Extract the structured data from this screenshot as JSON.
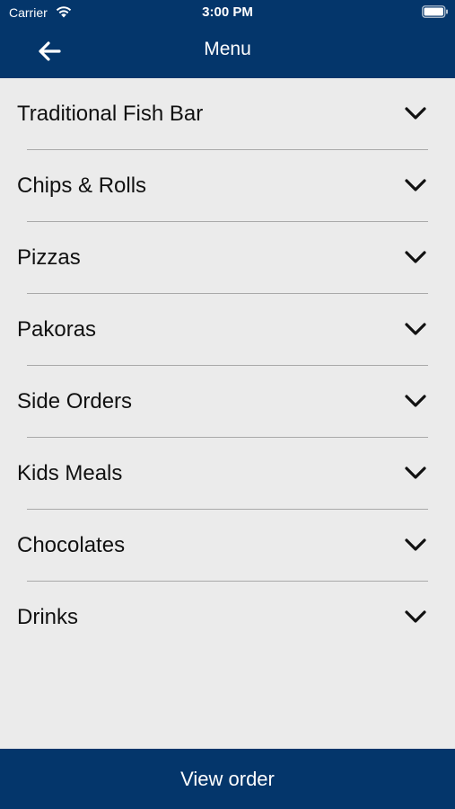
{
  "status_bar": {
    "carrier": "Carrier",
    "time": "3:00 PM",
    "icons": [
      "wifi-icon",
      "battery-icon"
    ]
  },
  "header": {
    "title": "Menu",
    "back_icon": "arrow-left-icon"
  },
  "menu": {
    "items": [
      {
        "label": "Traditional Fish Bar"
      },
      {
        "label": "Chips & Rolls"
      },
      {
        "label": "Pizzas"
      },
      {
        "label": "Pakoras"
      },
      {
        "label": "Side Orders"
      },
      {
        "label": "Kids Meals"
      },
      {
        "label": "Chocolates"
      },
      {
        "label": "Drinks"
      }
    ],
    "expand_icon": "chevron-down-icon"
  },
  "footer": {
    "view_order_label": "View order"
  },
  "colors": {
    "brand": "#04366b",
    "background": "#ebebeb",
    "divider": "#a9a9a9",
    "text": "#111111"
  }
}
